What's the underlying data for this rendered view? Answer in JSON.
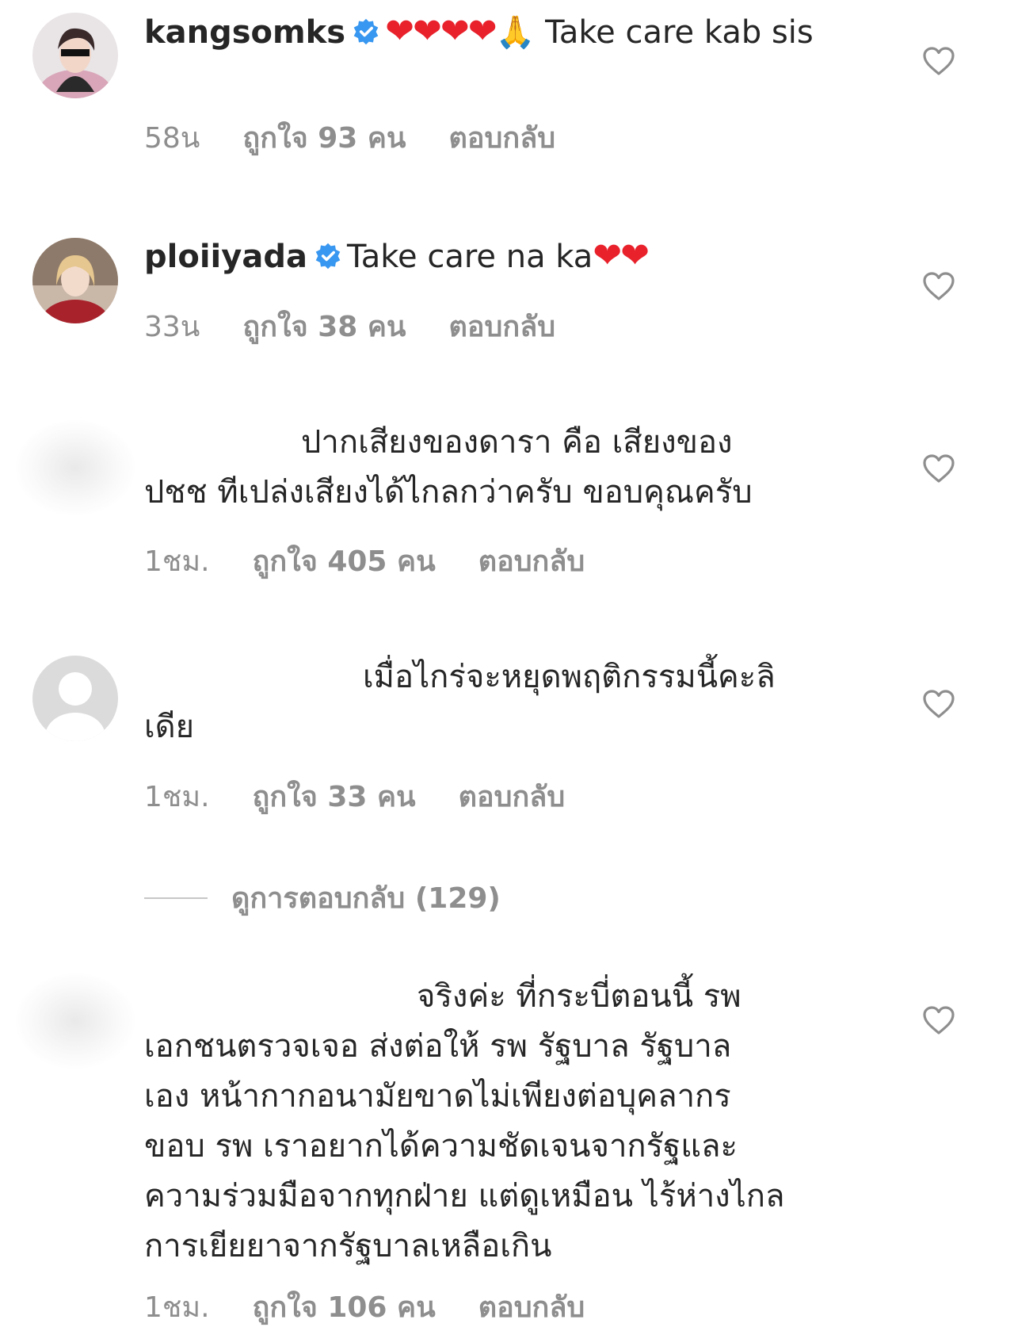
{
  "comments": [
    {
      "username": "kangsomks",
      "verified": true,
      "hearts": "❤❤❤❤",
      "emoji": "🙏",
      "text": "Take care kab sis",
      "time": "58น",
      "likes": "ถูกใจ 93 คน",
      "reply": "ตอบกลับ"
    },
    {
      "username": "ploiiyada",
      "verified": true,
      "text": "Take care na ka",
      "hearts": "❤❤",
      "time": "33น",
      "likes": "ถูกใจ 38 คน",
      "reply": "ตอบกลับ"
    },
    {
      "text_line1": "ปากเสียงของดารา คือ เสียงของ",
      "text_line2": "ปชช ทีเปล่งเสียงได้ไกลกว่าครับ ขอบคุณครับ",
      "time": "1ชม.",
      "likes": "ถูกใจ 405 คน",
      "reply": "ตอบกลับ"
    },
    {
      "text_line1": "เมื่อไกร่จะหยุดพฤติกรรมนี้คะลิ",
      "text_line2": "เดีย",
      "time": "1ชม.",
      "likes": "ถูกใจ 33 คน",
      "reply": "ตอบกลับ",
      "view_replies": "ดูการตอบกลับ (129)"
    },
    {
      "text_line1": "จริงค่ะ ที่กระบี่ตอนนี้ รพ",
      "text_line2": "เอกชนตรวจเจอ ส่งต่อให้  รพ รัฐบาล รัฐบาล",
      "text_line3": "เอง หน้ากากอนามัยขาดไม่เพียงต่อบุคลากร",
      "text_line4": "ขอบ รพ  เราอยากได้ความชัดเจนจากรัฐและ",
      "text_line5": "ความร่วมมือจากทุกฝ่าย แต่ดูเหมือน ไร้ห่างไกล",
      "text_line6": "การเยียยาจากรัฐบาลเหลือเกิน",
      "time": "1ชม.",
      "likes": "ถูกใจ 106 คน",
      "reply": "ตอบกลับ"
    }
  ],
  "colors": {
    "text": "#262626",
    "meta": "#8e8e8e",
    "verified": "#3897f0",
    "heart": "#e8212b"
  }
}
